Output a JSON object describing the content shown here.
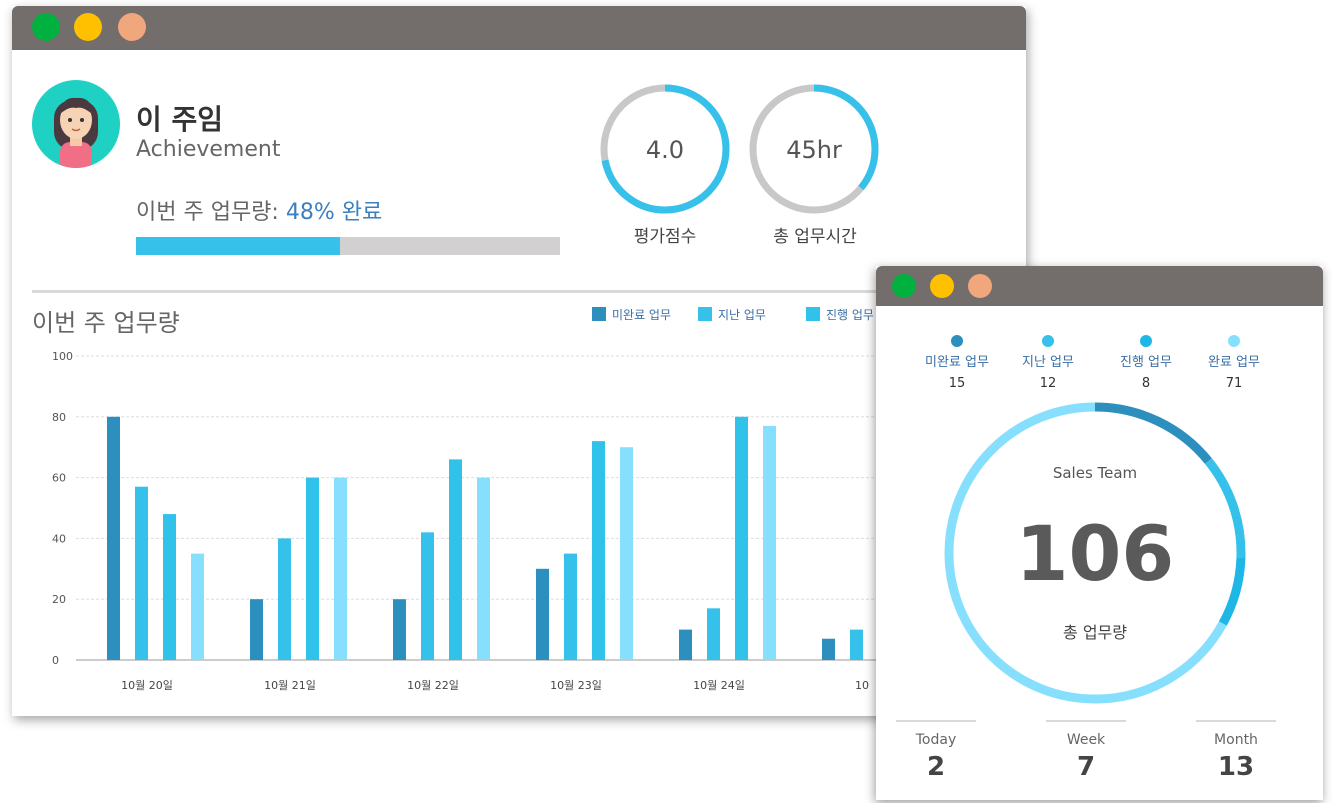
{
  "profile": {
    "name": "이 주임",
    "subtitle": "Achievement",
    "week_label": "이번 주 업무량:",
    "week_value": "48% 완료",
    "progress": 0.48
  },
  "rings": [
    {
      "value_text": "4.0",
      "label": "평가점수",
      "fill": 0.72
    },
    {
      "value_text": "45hr",
      "label": "총 업무시간",
      "fill": 0.36
    }
  ],
  "colors": {
    "titlebar": "#736e6c",
    "dot_green": "#00b140",
    "dot_yellow": "#ffc000",
    "dot_orange": "#f0a77c",
    "series": [
      "#2d8fbe",
      "#36c1ea",
      "#31c2ea",
      "#86e0fd"
    ],
    "accent": "#3a7fc1"
  },
  "chart_title": "이번 주 업무량",
  "chart_data": {
    "type": "bar",
    "title": "",
    "xlabel": "",
    "ylabel": "",
    "ylim": [
      0,
      100
    ],
    "yticks": [
      0,
      20,
      40,
      60,
      80,
      100
    ],
    "grid": true,
    "legend_position": "top-right",
    "categories": [
      "10월 20일",
      "10월 21일",
      "10월 22일",
      "10월 23일",
      "10월 24일",
      "10"
    ],
    "series": [
      {
        "name": "미완료 업무",
        "values": [
          80,
          20,
          20,
          30,
          10,
          7
        ]
      },
      {
        "name": "지난 업무",
        "values": [
          57,
          40,
          42,
          35,
          17,
          10
        ]
      },
      {
        "name": "진행 업무",
        "values": [
          48,
          60,
          66,
          72,
          80,
          null
        ]
      },
      {
        "name": "",
        "values": [
          35,
          60,
          60,
          70,
          77,
          null
        ]
      }
    ]
  },
  "legend": [
    {
      "label": "미완료 업무",
      "color": "#2d8fbe"
    },
    {
      "label": "지난 업무",
      "color": "#36c1ea"
    },
    {
      "label": "진행 업무",
      "color": "#31c2ea"
    }
  ],
  "team": {
    "stats": [
      {
        "label": "미완료 업무",
        "value": "15",
        "color": "#2d8fbe"
      },
      {
        "label": "지난 업무",
        "value": "12",
        "color": "#36c1ea"
      },
      {
        "label": "진행 업무",
        "value": "8",
        "color": "#1fb8e6"
      },
      {
        "label": "완료 업무",
        "value": "71",
        "color": "#86e0fd"
      }
    ],
    "name": "Sales Team",
    "total": "106",
    "total_label": "총 업무량",
    "donut": [
      15,
      12,
      8,
      71
    ],
    "bottom": [
      {
        "label": "Today",
        "value": "2"
      },
      {
        "label": "Week",
        "value": "7"
      },
      {
        "label": "Month",
        "value": "13"
      }
    ]
  }
}
